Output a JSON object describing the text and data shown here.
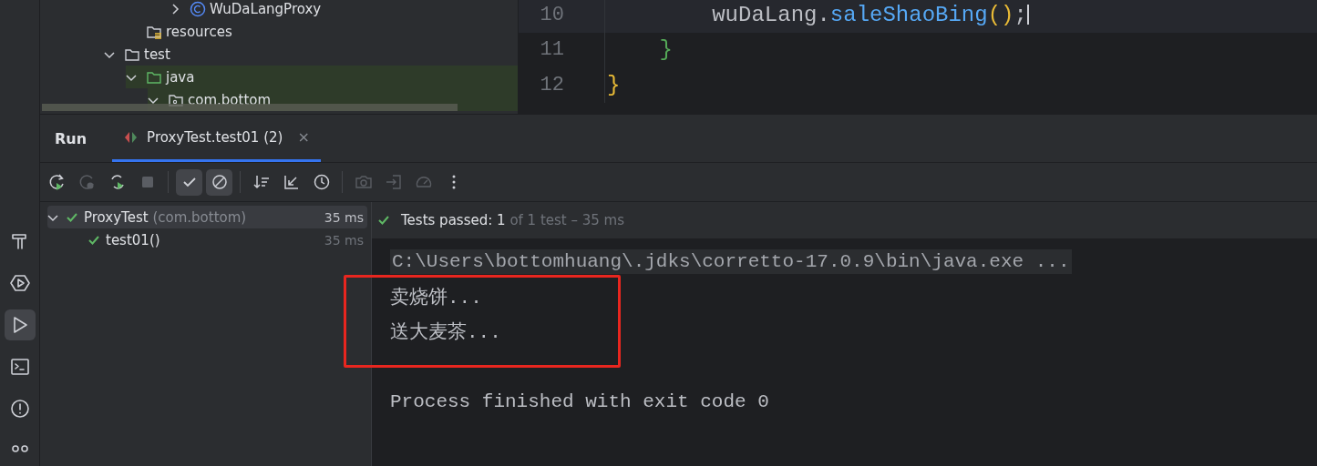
{
  "tool_strip": [
    {
      "kind": "build",
      "selected": false
    },
    {
      "kind": "services",
      "selected": false
    },
    {
      "kind": "run",
      "selected": true
    },
    {
      "kind": "terminal",
      "selected": false
    },
    {
      "kind": "problems",
      "selected": false
    },
    {
      "kind": "git",
      "selected": false
    }
  ],
  "project_tree": {
    "items": [
      {
        "children": [
          {
            "children": [
              {
                "children": [
                  {
                    "label": "WuDaLangProxy",
                    "kind": "class",
                    "expanded": false,
                    "highlighted": false
                  }
                ]
              }
            ]
          },
          {
            "label": "resources",
            "kind": "resources",
            "highlighted": false
          }
        ]
      },
      {
        "label": "test",
        "kind": "folder",
        "expanded": true,
        "highlighted": false,
        "children": [
          {
            "label": "java",
            "kind": "source",
            "expanded": true,
            "highlighted": true,
            "children": [
              {
                "label": "com.bottom",
                "kind": "package",
                "expanded": true,
                "highlighted": true
              }
            ]
          }
        ]
      }
    ]
  },
  "editor": {
    "lines": [
      {
        "number": "10",
        "current": true,
        "tokens": [
          {
            "text": "        wuDaLang.",
            "kind": "plain"
          },
          {
            "text": "saleShaoBing",
            "kind": "method"
          },
          {
            "text": "()",
            "kind": "paren"
          },
          {
            "text": ";",
            "kind": "plain"
          }
        ]
      },
      {
        "number": "11",
        "current": false,
        "tokens": [
          {
            "text": "    }",
            "kind": "brace2"
          }
        ]
      },
      {
        "number": "12",
        "current": false,
        "tokens": [
          {
            "text": "}",
            "kind": "brace1"
          }
        ]
      }
    ]
  },
  "run_panel": {
    "title": "Run",
    "tabs": [
      {
        "label": "ProxyTest.test01 (2)",
        "selected": true,
        "close": "×"
      }
    ],
    "toolbar": [
      {
        "kind": "rerun",
        "disabled": false,
        "on": false
      },
      {
        "kind": "rerun-failed",
        "disabled": true,
        "on": false
      },
      {
        "kind": "auto-rerun",
        "disabled": false,
        "on": false
      },
      {
        "kind": "stop",
        "disabled": true,
        "on": false
      },
      {
        "kind": "sep"
      },
      {
        "kind": "show-passed",
        "disabled": false,
        "on": true
      },
      {
        "kind": "show-ignored",
        "disabled": false,
        "on": true
      },
      {
        "kind": "sep"
      },
      {
        "kind": "sort",
        "disabled": false,
        "on": false
      },
      {
        "kind": "collapse",
        "disabled": false,
        "on": false
      },
      {
        "kind": "history",
        "disabled": false,
        "on": false
      },
      {
        "kind": "sep"
      },
      {
        "kind": "camera",
        "disabled": true,
        "on": false
      },
      {
        "kind": "import",
        "disabled": true,
        "on": false
      },
      {
        "kind": "gauge",
        "disabled": true,
        "on": false
      },
      {
        "kind": "more",
        "disabled": false,
        "on": false
      }
    ],
    "tests": [
      {
        "name": "ProxyTest",
        "detail": "(com.bottom)",
        "time": "35 ms",
        "passed": true,
        "expanded": true,
        "selected": true,
        "children": [
          {
            "name": "test01()",
            "time": "35 ms",
            "passed": true,
            "selected": false
          }
        ]
      }
    ],
    "status": {
      "passed": true,
      "main": "Tests passed: 1",
      "rest": "of 1 test – 35 ms"
    },
    "console": [
      {
        "text": "C:\\Users\\bottomhuang\\.jdks\\corretto-17.0.9\\bin\\java.exe ...",
        "kind": "command"
      },
      {
        "text": "卖烧饼...",
        "kind": "output"
      },
      {
        "text": "送大麦茶...",
        "kind": "output"
      },
      {
        "kind": "blank"
      },
      {
        "text": "Process finished with exit code 0",
        "kind": "output"
      }
    ]
  }
}
